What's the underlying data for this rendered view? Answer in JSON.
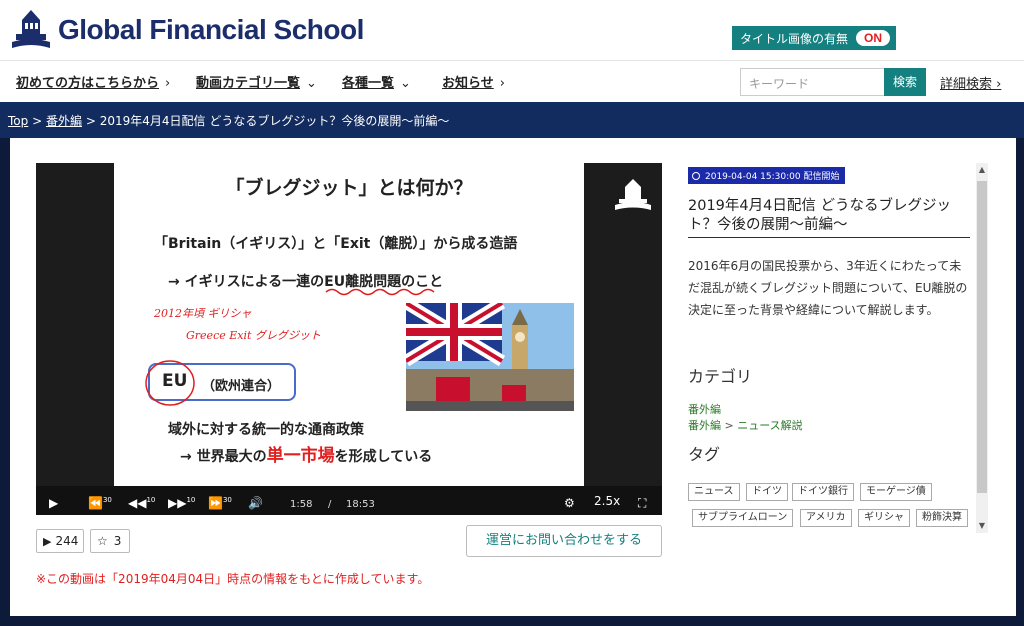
{
  "header": {
    "logo_text": "Global Financial School",
    "title_toggle_label": "タイトル画像の有無",
    "title_toggle_state": "ON"
  },
  "nav": {
    "items": [
      {
        "label": "初めての方はこちらから",
        "chevron": "›"
      },
      {
        "label": "動画カテゴリ一覧",
        "chevron": "⌄"
      },
      {
        "label": "各種一覧",
        "chevron": "⌄"
      },
      {
        "label": "お知らせ",
        "chevron": "›"
      }
    ],
    "search_placeholder": "キーワード",
    "search_button": "検索",
    "advanced_search": "詳細検索",
    "advanced_chevron": "›"
  },
  "breadcrumb": {
    "top": "Top",
    "section": "番外編",
    "current": "2019年4月4日配信 どうなるブレグジット？今後の展開〜前編〜",
    "separator": ">"
  },
  "video": {
    "slide_title": "「ブレグジット」とは何か？",
    "line1": "「Britain（イギリス）」と「Exit（離脱）」から成る造語",
    "line2": "→ イギリスによる一連のEU離脱問題のこと",
    "hand1": "2012年頃  ギリシャ",
    "hand2": "Greece  Exit   グレグジット",
    "eu": "EU",
    "eu_sub": "（欧州連合）",
    "line3": "域外に対する統一的な通商政策",
    "line4_a": "→ 世界最大の",
    "line4_red": "単一市場",
    "line4_b": "を形成している",
    "current_time": "1:58",
    "time_sep": "/",
    "duration": "18:53",
    "speed": "2.5x",
    "progress": 0.104,
    "skip_back_label": "30",
    "back_label": "10",
    "fwd_label": "10",
    "skip_fwd_label": "30"
  },
  "stats": {
    "views": "244",
    "favorites": "3"
  },
  "contact_button": "運営にお問い合わせをする",
  "notice": "※この動画は「2019年04月04日」時点の情報をもとに作成しています。",
  "info": {
    "badge": "2019-04-04 15:30:00 配信開始",
    "title": "2019年4月4日配信 どうなるブレグジット？今後の展開〜前編〜",
    "description": "2016年6月の国民投票から、3年近くにわたって未だ混乱が続くブレグジット問題について、EU離脱の決定に至った背景や経緯について解説します。",
    "category_heading": "カテゴリ",
    "category_1": "番外編",
    "category_2_parent": "番外編",
    "category_2_sep": ">",
    "category_2_child": "ニュース解説",
    "tag_heading": "タグ",
    "tags": [
      "ニュース",
      "ドイツ",
      "ドイツ銀行",
      "モーゲージ債",
      "サブプライムローン",
      "アメリカ",
      "ギリシャ",
      "粉飾決算"
    ]
  },
  "colors": {
    "navy": "#1b2d6b",
    "teal": "#14807f",
    "red": "#e02020",
    "badge_blue": "#1a2aa8",
    "progress_pink": "#e0257a"
  }
}
